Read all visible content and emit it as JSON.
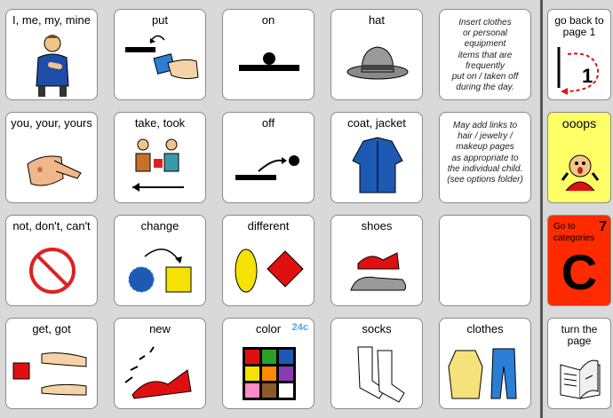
{
  "cells": {
    "i_me": "I, me, my, mine",
    "put": "put",
    "on": "on",
    "hat": "hat",
    "you": "you, your, yours",
    "take": "take, took",
    "off": "off",
    "coat": "coat,  jacket",
    "not": "not, don't, can't",
    "change": "change",
    "different": "different",
    "shoes": "shoes",
    "get": "get, got",
    "new": "new",
    "color": "color",
    "color_tag": "24c",
    "socks": "socks",
    "clothes": "clothes"
  },
  "notes": {
    "insert": "Insert clothes\nor personal\nequipment\nitems that are\nfrequently\nput on / taken off\nduring the day.",
    "links": "May add links to\nhair / jewelry /\nmakeup pages\nas appropriate to\nthe individual child.\n(see options folder)"
  },
  "side": {
    "back": "go back to\npage 1",
    "back_num": "1",
    "ooops": "ooops",
    "categories": "Go to\ncategories",
    "categories_num": "7",
    "categories_letter": "C",
    "turn": "turn the\npage"
  },
  "colors": {
    "ooops_bg": "#ffff66",
    "categories_bg": "#ff2a00",
    "tag": "#4aa8e8"
  },
  "icons": [
    "person-pointing-self-icon",
    "hand-putting-box-icon",
    "on-symbol-icon",
    "hat-icon",
    "pointing-finger-icon",
    "two-people-exchange-icon",
    "off-symbol-icon",
    "jacket-icon",
    "no-sign-icon",
    "circle-to-square-icon",
    "oval-and-diamond-icon",
    "red-and-gray-shoes-icon",
    "hands-receive-icon",
    "new-shoe-icon",
    "color-palette-icon",
    "socks-icon",
    "clothes-icon",
    "go-back-arrow-icon",
    "surprised-face-icon",
    "book-page-turn-icon"
  ]
}
